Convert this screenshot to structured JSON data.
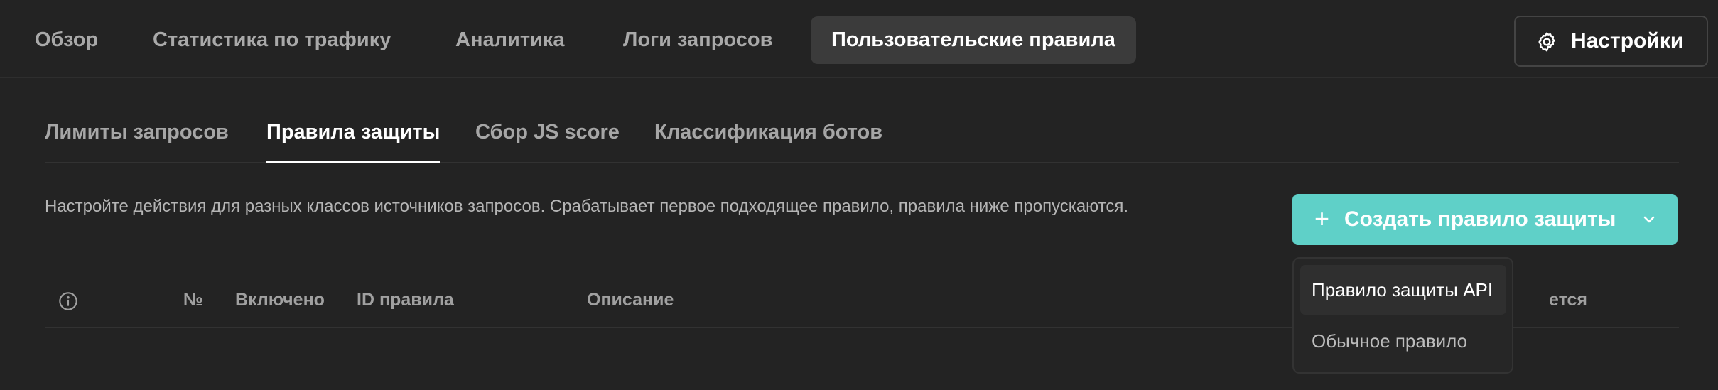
{
  "top_tabs": [
    {
      "label": "Обзор"
    },
    {
      "label": "Статистика по трафику"
    },
    {
      "label": "Аналитика"
    },
    {
      "label": "Логи запросов"
    },
    {
      "label": "Пользовательские правила"
    }
  ],
  "settings": {
    "label": "Настройки",
    "icon": "gear-icon"
  },
  "sub_tabs": [
    {
      "label": "Лимиты запросов"
    },
    {
      "label": "Правила защиты"
    },
    {
      "label": "Сбор JS score"
    },
    {
      "label": "Классификация ботов"
    }
  ],
  "description": "Настройте действия для разных классов источников запросов. Срабатывает первое подходящее правило, правила ниже пропускаются.",
  "create_button": {
    "label": "Создать правило защиты",
    "plus": "+",
    "icon": "chevron-down-icon"
  },
  "table": {
    "columns": [
      "№",
      "Включено",
      "ID правила",
      "Описание",
      "ется"
    ]
  },
  "dropdown": {
    "items": [
      {
        "label": "Правило защиты API"
      },
      {
        "label": "Обычное правило"
      }
    ]
  },
  "colors": {
    "background": "#232323",
    "accent": "#5fd0c8",
    "active_tab": "#3b3b3b"
  }
}
